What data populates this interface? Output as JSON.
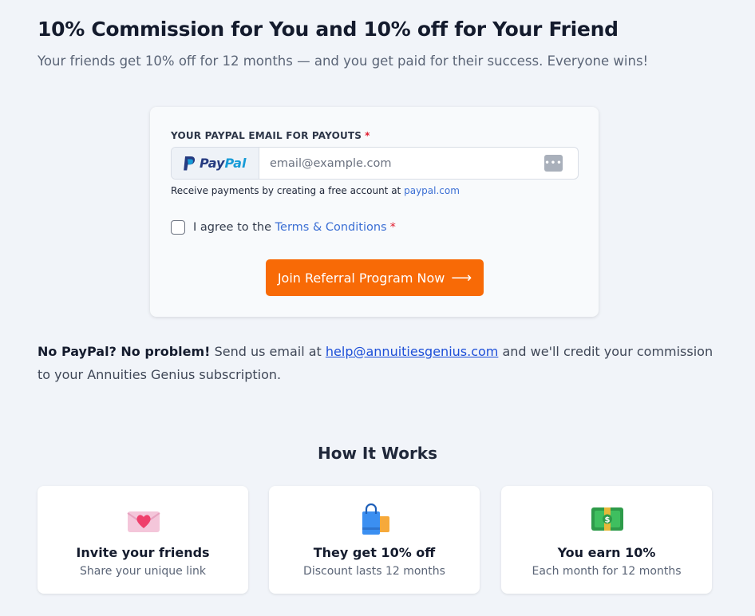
{
  "header": {
    "title": "10% Commission for You and 10% off for Your Friend",
    "subtitle": "Your friends get 10% off for 12 months — and you get paid for their success. Everyone wins!"
  },
  "form": {
    "field_label": "YOUR PAYPAL EMAIL FOR PAYOUTS",
    "required_mark": "*",
    "paypal_brand_a": "Pay",
    "paypal_brand_b": "Pal",
    "email_placeholder": "email@example.com",
    "email_value": "",
    "help_text": "Receive payments by creating a free account at",
    "help_link": "paypal.com",
    "agree_text": "I agree to the",
    "terms_link": "Terms & Conditions",
    "agree_checked": false,
    "cta_label": "Join Referral Program Now",
    "cta_color": "#f86a06"
  },
  "no_paypal": {
    "bold": "No PayPal? No problem!",
    "text_before": "Send us email at",
    "email_link": "help@annuitiesgenius.com",
    "text_after": "and we'll credit your commission to your Annuities Genius subscription."
  },
  "how_it_works": {
    "title": "How It Works",
    "steps": [
      {
        "icon": "love-letter-icon",
        "title": "Invite your friends",
        "desc": "Share your unique link"
      },
      {
        "icon": "shopping-bags-icon",
        "title": "They get 10% off",
        "desc": "Discount lasts 12 months"
      },
      {
        "icon": "money-icon",
        "title": "You earn 10%",
        "desc": "Each month for 12 months"
      }
    ]
  }
}
